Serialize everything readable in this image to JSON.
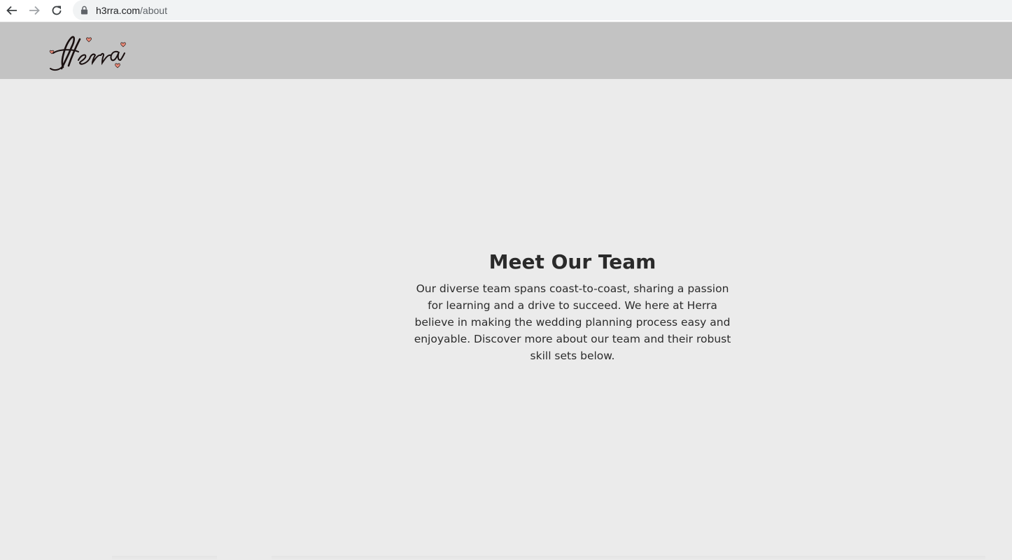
{
  "browser": {
    "url_host": "h3rra.com",
    "url_path": "/about"
  },
  "header": {
    "logo_text": "Herra"
  },
  "team": {
    "title": "Meet Our Team",
    "description": "Our diverse team spans coast-to-coast, sharing a passion for learning and a drive to succeed. We here at Herra believe in making the wedding planning process easy and enjoyable. Discover more about our team and their robust skill sets below."
  },
  "colors": {
    "header_bg": "#c3c3c3",
    "page_bg": "#ebebeb",
    "heart": "#e88a78"
  }
}
